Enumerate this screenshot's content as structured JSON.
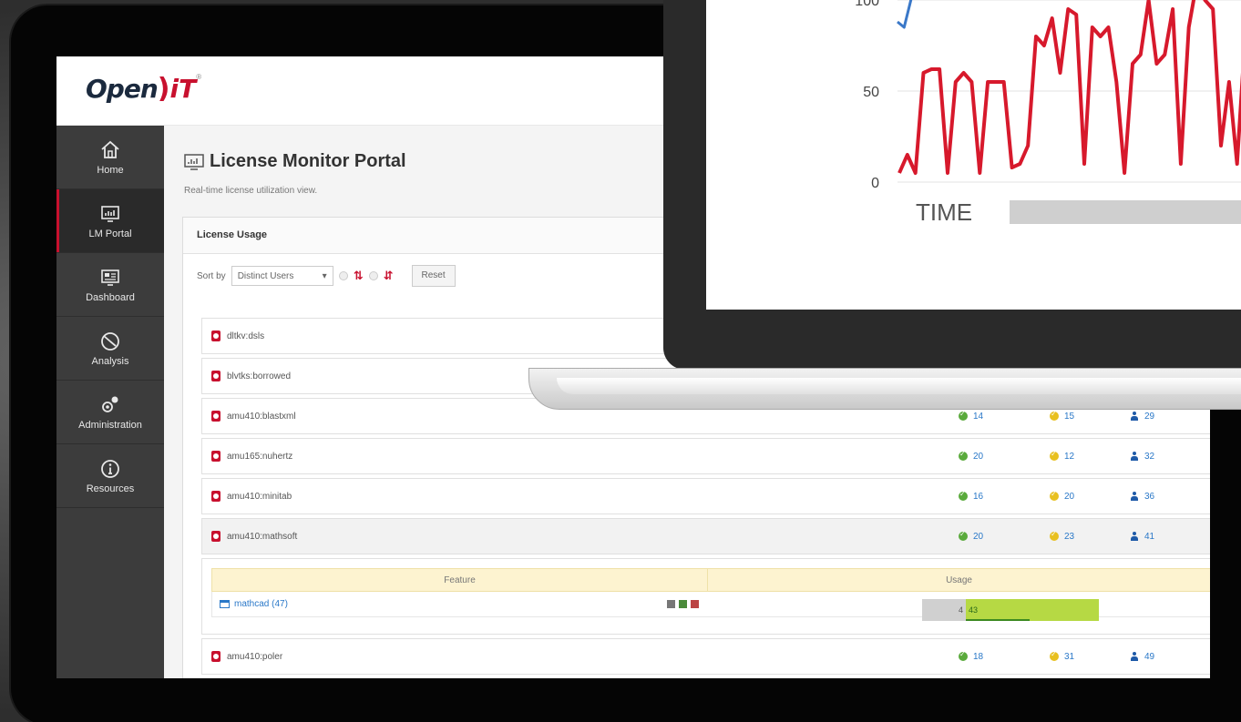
{
  "app": {
    "logo_open": "Open",
    "logo_paren": ")",
    "logo_it": "iT",
    "logo_reg": "®"
  },
  "sidebar": {
    "items": [
      {
        "label": "Home",
        "icon": "home-icon",
        "active": false
      },
      {
        "label": "LM Portal",
        "icon": "monitor-icon",
        "active": true
      },
      {
        "label": "Dashboard",
        "icon": "dashboard-icon",
        "active": false
      },
      {
        "label": "Analysis",
        "icon": "analysis-icon",
        "active": false
      },
      {
        "label": "Administration",
        "icon": "gears-icon",
        "active": false
      },
      {
        "label": "Resources",
        "icon": "info-icon",
        "active": false
      }
    ]
  },
  "page": {
    "title": "License Monitor Portal",
    "subtitle": "Real-time license utilization view."
  },
  "panel": {
    "title": "License Usage",
    "sort_label": "Sort by",
    "sort_value": "Distinct Users",
    "reset_label": "Reset"
  },
  "rows": [
    {
      "name": "dltkv:dsls",
      "a": "",
      "b": "",
      "c": ""
    },
    {
      "name": "blvtks:borrowed",
      "a": "",
      "b": "",
      "c": ""
    },
    {
      "name": "amu410:blastxml",
      "a": "14",
      "b": "15",
      "c": "29"
    },
    {
      "name": "amu165:nuhertz",
      "a": "20",
      "b": "12",
      "c": "32"
    },
    {
      "name": "amu410:minitab",
      "a": "16",
      "b": "20",
      "c": "36"
    },
    {
      "name": "amu410:mathsoft",
      "a": "20",
      "b": "23",
      "c": "41"
    },
    {
      "name": "amu410:poler",
      "a": "18",
      "b": "31",
      "c": "49"
    }
  ],
  "feature_table": {
    "col_feature": "Feature",
    "col_usage": "Usage",
    "feature_name": "mathcad (47)",
    "usage_a": "4",
    "usage_b": "43"
  },
  "chart_data": {
    "type": "line",
    "title": "",
    "xlabel": "TIME",
    "ylabel": "",
    "ylim": [
      0,
      120
    ],
    "yticks": [
      0,
      50,
      100
    ],
    "series": [
      {
        "color": "#d7192c",
        "values": [
          5,
          15,
          5,
          60,
          62,
          62,
          5,
          55,
          60,
          55,
          5,
          55,
          55,
          55,
          8,
          10,
          20,
          80,
          75,
          90,
          60,
          95,
          92,
          10,
          85,
          80,
          85,
          55,
          5,
          65,
          70,
          100,
          65,
          70,
          95,
          10,
          85,
          110,
          100,
          95,
          20,
          55,
          10,
          80,
          100,
          90,
          5
        ]
      },
      {
        "color": "#3a78c8",
        "values": [
          88,
          85,
          100,
          110
        ]
      }
    ],
    "colors": {
      "red": "#d7192c",
      "blue": "#3a78c8"
    }
  }
}
